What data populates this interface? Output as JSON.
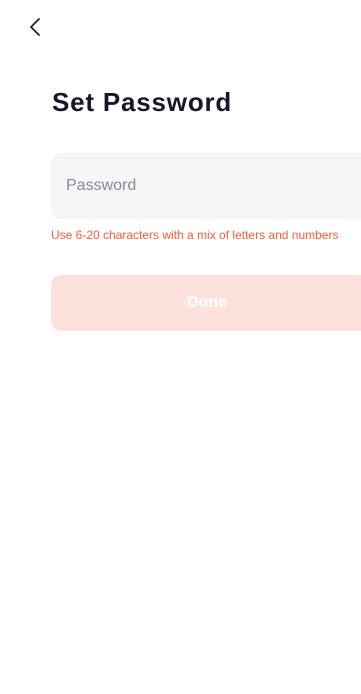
{
  "nav": {
    "back_icon": "chevron-left-icon"
  },
  "page": {
    "title": "Set Password"
  },
  "password_field": {
    "value": "",
    "placeholder": "Password"
  },
  "hint": {
    "text": "Use 6-20 characters with a mix of letters and numbers"
  },
  "done_button": {
    "label": "Done",
    "enabled": false
  },
  "colors": {
    "title": "#17172b",
    "hint": "#ff5a36",
    "button_disabled_bg": "#fde2dc",
    "field_bg": "#f6f6f8"
  }
}
